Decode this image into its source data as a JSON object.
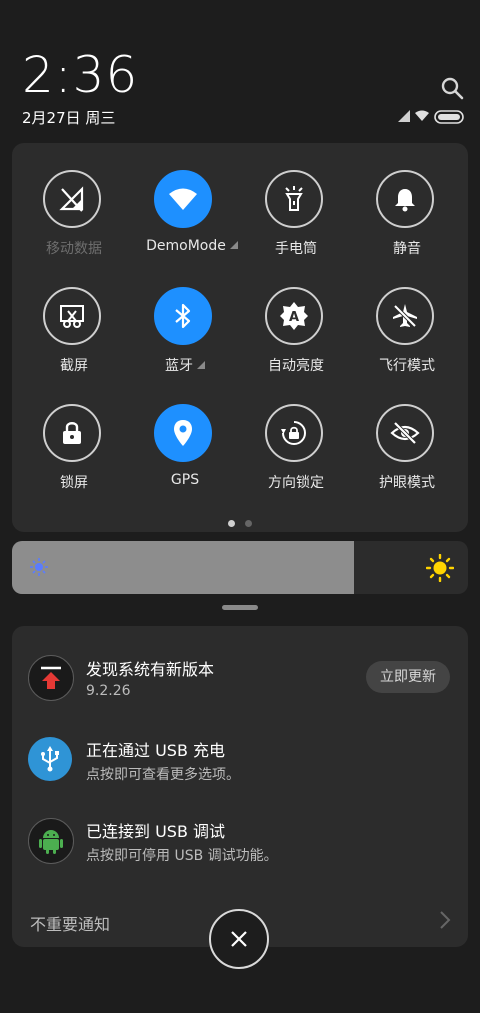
{
  "header": {
    "time": "2:36",
    "date": "2月27日 周三"
  },
  "quick_settings": {
    "tiles": [
      {
        "label": "移动数据",
        "icon": "mobile-data-off-icon",
        "active": false,
        "disabled": true
      },
      {
        "label": "DemoMode",
        "icon": "wifi-icon",
        "active": true,
        "has_submenu": true
      },
      {
        "label": "手电筒",
        "icon": "flashlight-icon",
        "active": false
      },
      {
        "label": "静音",
        "icon": "bell-icon",
        "active": false
      },
      {
        "label": "截屏",
        "icon": "screenshot-icon",
        "active": false
      },
      {
        "label": "蓝牙",
        "icon": "bluetooth-icon",
        "active": true,
        "has_submenu": true
      },
      {
        "label": "自动亮度",
        "icon": "auto-brightness-icon",
        "active": false
      },
      {
        "label": "飞行模式",
        "icon": "airplane-off-icon",
        "active": false
      },
      {
        "label": "锁屏",
        "icon": "lock-icon",
        "active": false
      },
      {
        "label": "GPS",
        "icon": "location-pin-icon",
        "active": true
      },
      {
        "label": "方向锁定",
        "icon": "rotation-lock-icon",
        "active": false
      },
      {
        "label": "护眼模式",
        "icon": "eye-off-icon",
        "active": false
      }
    ],
    "page_index": 0,
    "page_count": 2
  },
  "brightness": {
    "level": 0.75,
    "low_icon": "sun-small-icon",
    "high_icon": "sun-large-icon"
  },
  "notifications": [
    {
      "title": "发现系统有新版本",
      "subtitle": "9.2.26",
      "icon": "system-update-icon",
      "action": "立即更新"
    },
    {
      "title": "正在通过 USB 充电",
      "subtitle": "点按即可查看更多选项。",
      "icon": "usb-icon"
    },
    {
      "title": "已连接到 USB 调试",
      "subtitle": "点按即可停用 USB 调试功能。",
      "icon": "android-icon"
    }
  ],
  "unimportant_label": "不重要通知",
  "colors": {
    "accent": "#1e90ff",
    "panel": "#2c2c2c",
    "background": "#1d1d1d",
    "sun": "#ffd400"
  }
}
